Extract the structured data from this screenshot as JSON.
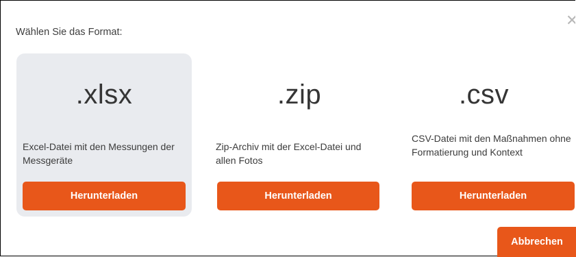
{
  "dialog": {
    "prompt": "Wählen Sie das Format:",
    "close_icon": "close-icon",
    "cancel_label": "Abbrechen"
  },
  "formats": [
    {
      "extension": ".xlsx",
      "description": "Excel-Datei mit den Messungen der Messgeräte",
      "button_label": "Herunterladen",
      "selected": true
    },
    {
      "extension": ".zip",
      "description": "Zip-Archiv mit der Excel-Datei und allen Fotos",
      "button_label": "Herunterladen",
      "selected": false
    },
    {
      "extension": ".csv",
      "description": "CSV-Datei mit den Maßnahmen ohne Formatierung und Kontext",
      "button_label": "Herunterladen",
      "selected": false
    }
  ],
  "colors": {
    "accent": "#e8571a",
    "selected_card_bg": "#e9ebef",
    "text": "#3a3a3a"
  }
}
